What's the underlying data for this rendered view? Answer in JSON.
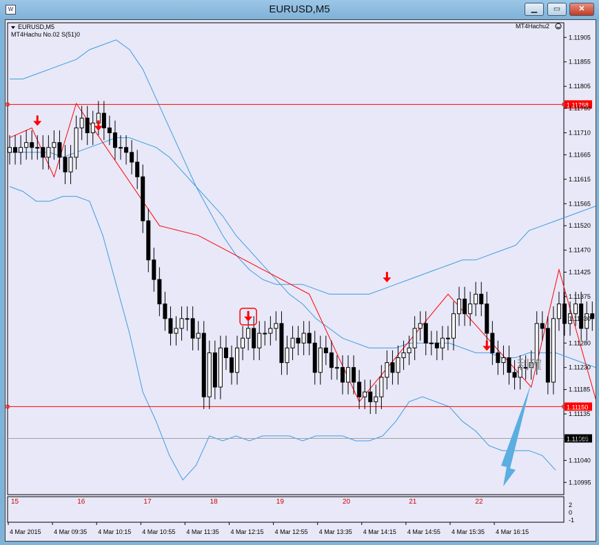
{
  "window": {
    "title": "EURUSD,M5",
    "icon_name": "chart-window-icon",
    "buttons": [
      "minimize-icon",
      "maximize-icon",
      "close-icon"
    ]
  },
  "chart_header": {
    "symbol_line": "EURUSD,M5",
    "indicator_line": "MT4Hachu  No.02  S(51)0",
    "ea_label": "MT4Hachu2",
    "ea_icon": "smiley-icon"
  },
  "annotation": {
    "text": "利確",
    "color": "#5aaee0"
  },
  "colors": {
    "background": "#e8e8f8",
    "grid_axis": "#000000",
    "bollinger": "#3d9be0",
    "zigzag": "#ff0000",
    "signal_arrow": "#ff0000",
    "level_line": "#ff0000",
    "price_tag": "#ff0000",
    "bid_line": "#a0a0a0",
    "bid_tag": "#000000"
  },
  "chart_data": {
    "type": "candlestick",
    "symbol": "EURUSD",
    "timeframe": "M5",
    "ylim": [
      1.1097,
      1.11935
    ],
    "y_ticks": [
      "1.11905",
      "1.11855",
      "1.11805",
      "1.11760",
      "1.11710",
      "1.11665",
      "1.11615",
      "1.11565",
      "1.11520",
      "1.11470",
      "1.11425",
      "1.11375",
      "1.11330",
      "1.11280",
      "1.11230",
      "1.11185",
      "1.11135",
      "1.11085",
      "1.11040",
      "1.10995"
    ],
    "x_ticks": [
      "4 Mar 2015",
      "4 Mar 09:35",
      "4 Mar 10:15",
      "4 Mar 10:55",
      "4 Mar 11:35",
      "4 Mar 12:15",
      "4 Mar 12:55",
      "4 Mar 13:35",
      "4 Mar 14:15",
      "4 Mar 14:55",
      "4 Mar 15:35",
      "4 Mar 16:15"
    ],
    "candle_step": 8.05,
    "opens": [
      1.1167,
      1.1168,
      1.1167,
      1.1168,
      1.1169,
      1.1168,
      1.1168,
      1.1166,
      1.1168,
      1.1169,
      1.1166,
      1.1163,
      1.1166,
      1.1172,
      1.1174,
      1.1171,
      1.1173,
      1.1175,
      1.1172,
      1.1171,
      1.1168,
      1.1168,
      1.1167,
      1.1165,
      1.1162,
      1.1153,
      1.1145,
      1.1141,
      1.1136,
      1.1133,
      1.113,
      1.1131,
      1.1133,
      1.1133,
      1.1129,
      1.113,
      1.1117,
      1.1126,
      1.1119,
      1.1127,
      1.1125,
      1.1122,
      1.1127,
      1.1129,
      1.1131,
      1.1127,
      1.113,
      1.113,
      1.1131,
      1.1132,
      1.1124,
      1.1127,
      1.1129,
      1.1128,
      1.113,
      1.1128,
      1.1122,
      1.1127,
      1.1126,
      1.1123,
      1.1123,
      1.112,
      1.1123,
      1.112,
      1.1117,
      1.1118,
      1.1116,
      1.1117,
      1.1121,
      1.1124,
      1.1122,
      1.1125,
      1.1126,
      1.1127,
      1.1131,
      1.1132,
      1.1128,
      1.1128,
      1.1127,
      1.1129,
      1.1129,
      1.1134,
      1.1137,
      1.1134,
      1.1136,
      1.1138,
      1.1136,
      1.113,
      1.1126,
      1.1124,
      1.1125,
      1.1122,
      1.1121,
      1.1123,
      1.1123,
      1.1124,
      1.1132,
      1.1131,
      1.112,
      1.1133,
      1.1136,
      1.1132,
      1.1134,
      1.1136,
      1.1131,
      1.1134,
      1.1133,
      1.1129,
      1.1124,
      1.1121,
      1.1114
    ],
    "closes": [
      1.1168,
      1.1167,
      1.1168,
      1.1169,
      1.1168,
      1.1168,
      1.1166,
      1.1168,
      1.1169,
      1.1166,
      1.1163,
      1.1166,
      1.1172,
      1.1174,
      1.1171,
      1.1173,
      1.1175,
      1.1172,
      1.1171,
      1.1168,
      1.1168,
      1.1167,
      1.1165,
      1.1162,
      1.1153,
      1.1145,
      1.1141,
      1.1136,
      1.1133,
      1.113,
      1.1131,
      1.1133,
      1.1133,
      1.1129,
      1.113,
      1.1117,
      1.1126,
      1.1119,
      1.1127,
      1.1125,
      1.1122,
      1.1127,
      1.1129,
      1.1131,
      1.1127,
      1.113,
      1.113,
      1.1131,
      1.1132,
      1.1124,
      1.1127,
      1.1129,
      1.1128,
      1.113,
      1.1128,
      1.1122,
      1.1127,
      1.1126,
      1.1123,
      1.1123,
      1.112,
      1.1123,
      1.112,
      1.1117,
      1.1118,
      1.1116,
      1.1117,
      1.1121,
      1.1124,
      1.1122,
      1.1125,
      1.1126,
      1.1127,
      1.1131,
      1.1132,
      1.1128,
      1.1128,
      1.1127,
      1.1129,
      1.1129,
      1.1134,
      1.1137,
      1.1134,
      1.1136,
      1.1138,
      1.1136,
      1.113,
      1.1126,
      1.1124,
      1.1125,
      1.1122,
      1.1121,
      1.1123,
      1.1123,
      1.1124,
      1.1132,
      1.1131,
      1.112,
      1.1133,
      1.1136,
      1.1132,
      1.1134,
      1.1136,
      1.1131,
      1.1134,
      1.1133,
      1.1129,
      1.1124,
      1.1121,
      1.1114,
      1.1109
    ],
    "zigzag": [
      [
        0,
        1.117
      ],
      [
        4,
        1.1172
      ],
      [
        8,
        1.1162
      ],
      [
        12,
        1.1177
      ],
      [
        27,
        1.1152
      ],
      [
        34,
        1.115
      ],
      [
        54,
        1.1138
      ],
      [
        63,
        1.1116
      ],
      [
        79,
        1.1138
      ],
      [
        94,
        1.1119
      ],
      [
        99,
        1.1143
      ],
      [
        109,
        1.1103
      ]
    ],
    "bb_middle": [
      1.1167,
      1.1167,
      1.1167,
      1.1167,
      1.1166,
      1.1167,
      1.1168,
      1.1169,
      1.117,
      1.117,
      1.1169,
      1.1168,
      1.1166,
      1.1163,
      1.116,
      1.1157,
      1.1154,
      1.115,
      1.1147,
      1.1144,
      1.1141,
      1.1138,
      1.1136,
      1.1133,
      1.1131,
      1.1129,
      1.1128,
      1.1127,
      1.1127,
      1.1127,
      1.1128,
      1.1128,
      1.1128,
      1.1128,
      1.1127,
      1.1126,
      1.1126,
      1.1125,
      1.1125,
      1.1126,
      1.1126,
      1.1126,
      1.1125,
      1.1124,
      1.1123,
      1.1122,
      1.1122,
      1.1123,
      1.1124,
      1.1125,
      1.1126,
      1.1127,
      1.1128,
      1.1129,
      1.1128,
      1.1127,
      1.1125,
      1.1124,
      1.1125,
      1.1126,
      1.1128,
      1.1128,
      1.1129,
      1.1129,
      1.1129
    ],
    "bb_upper": [
      1.1182,
      1.1182,
      1.1183,
      1.1184,
      1.1185,
      1.1186,
      1.1188,
      1.1189,
      1.119,
      1.1188,
      1.1184,
      1.1178,
      1.1172,
      1.1166,
      1.116,
      1.1155,
      1.115,
      1.1146,
      1.1143,
      1.1141,
      1.114,
      1.114,
      1.114,
      1.1139,
      1.1138,
      1.1138,
      1.1138,
      1.1138,
      1.1139,
      1.114,
      1.1141,
      1.1142,
      1.1143,
      1.1144,
      1.1145,
      1.1145,
      1.1146,
      1.1147,
      1.1148,
      1.1151,
      1.1152,
      1.1153,
      1.1154,
      1.1155,
      1.1156,
      1.1156,
      1.1156
    ],
    "bb_lower": [
      1.116,
      1.1159,
      1.1157,
      1.1157,
      1.1158,
      1.1158,
      1.1157,
      1.115,
      1.114,
      1.113,
      1.1118,
      1.1112,
      1.1105,
      1.11,
      1.1103,
      1.1109,
      1.1108,
      1.1109,
      1.1108,
      1.1109,
      1.1109,
      1.1109,
      1.1108,
      1.1109,
      1.1109,
      1.1109,
      1.1108,
      1.1108,
      1.1109,
      1.1112,
      1.1116,
      1.1117,
      1.1116,
      1.1115,
      1.1112,
      1.111,
      1.1107,
      1.1106,
      1.1106,
      1.1106,
      1.1105,
      1.1102
    ],
    "levels": [
      {
        "label": "1.11768",
        "value": 1.11768
      },
      {
        "label": "1.11150",
        "value": 1.1115
      }
    ],
    "bid": {
      "label": "1.11085",
      "value": 1.11085
    },
    "signals": [
      {
        "type": "sell",
        "index": 5,
        "value": 1.1172
      },
      {
        "type": "sell",
        "index": 16,
        "value": 1.1171
      },
      {
        "type": "sell",
        "index": 43,
        "value": 1.1132,
        "highlighted": true
      },
      {
        "type": "sell",
        "index": 68,
        "value": 1.114
      },
      {
        "type": "sell",
        "index": 86,
        "value": 1.1126
      }
    ],
    "sub_window": {
      "x_labels": [
        "15",
        "16",
        "17",
        "18",
        "19",
        "20",
        "21",
        "22"
      ],
      "y_labels": [
        "2",
        "0",
        "-1"
      ]
    }
  }
}
